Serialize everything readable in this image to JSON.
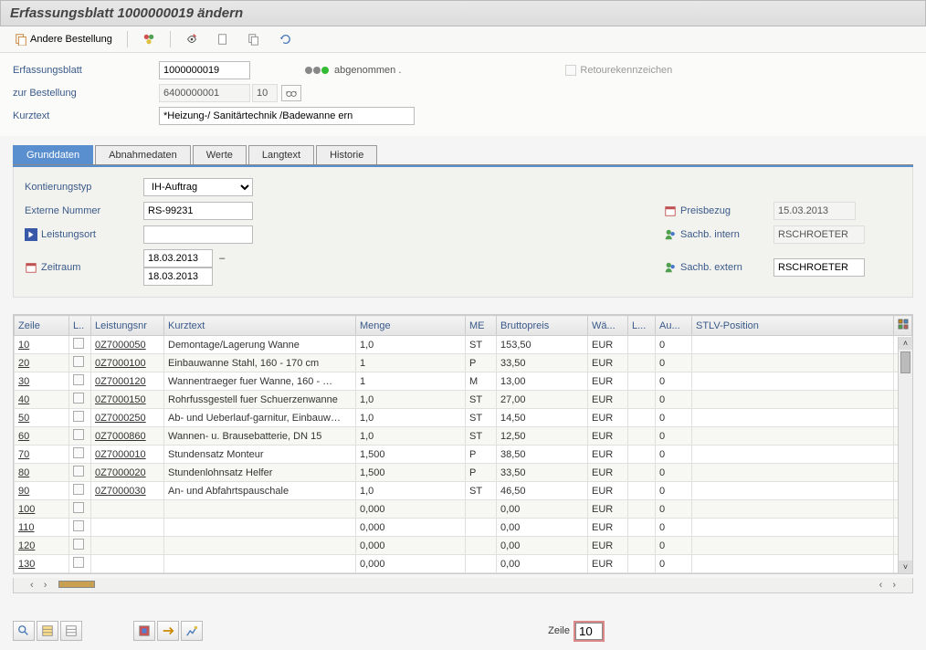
{
  "title": "Erfassungsblatt 1000000019 ändern",
  "toolbar": {
    "other_order": "Andere Bestellung"
  },
  "header": {
    "erfassungsblatt_label": "Erfassungsblatt",
    "erfassungsblatt_value": "1000000019",
    "zur_bestellung_label": "zur Bestellung",
    "bestellung_value": "6400000001",
    "bestellung_pos": "10",
    "kurztext_label": "Kurztext",
    "kurztext_value": "*Heizung-/ Sanitärtechnik /Badewanne ern",
    "status_text": "abgenommen .",
    "retoure_label": "Retourekennzeichen"
  },
  "tabs": [
    "Grunddaten",
    "Abnahmedaten",
    "Werte",
    "Langtext",
    "Historie"
  ],
  "grunddaten": {
    "kontierungstyp_label": "Kontierungstyp",
    "kontierungstyp_value": "IH-Auftrag",
    "externe_nummer_label": "Externe Nummer",
    "externe_nummer_value": "RS-99231",
    "leistungsort_label": "Leistungsort",
    "leistungsort_value": "",
    "zeitraum_label": "Zeitraum",
    "zeitraum_from": "18.03.2013",
    "zeitraum_sep": "–",
    "zeitraum_to": "18.03.2013",
    "preisbezug_label": "Preisbezug",
    "preisbezug_value": "15.03.2013",
    "sachb_intern_label": "Sachb. intern",
    "sachb_intern_value": "RSCHROETER",
    "sachb_extern_label": "Sachb. extern",
    "sachb_extern_value": "RSCHROETER"
  },
  "table": {
    "headers": {
      "zeile": "Zeile",
      "l": "L..",
      "leistungsnr": "Leistungsnr",
      "kurztext": "Kurztext",
      "menge": "Menge",
      "me": "ME",
      "bruttopreis": "Bruttopreis",
      "wae": "Wä...",
      "l2": "L...",
      "au": "Au...",
      "stlv": "STLV-Position"
    },
    "rows": [
      {
        "zeile": "10",
        "lnr": "0Z7000050",
        "txt": "Demontage/Lagerung Wanne",
        "menge": "1,0",
        "me": "ST",
        "preis": "153,50",
        "wae": "EUR",
        "au": "0"
      },
      {
        "zeile": "20",
        "lnr": "0Z7000100",
        "txt": "Einbauwanne Stahl, 160 - 170 cm",
        "menge": "1",
        "me": "P",
        "preis": "33,50",
        "wae": "EUR",
        "au": "0"
      },
      {
        "zeile": "30",
        "lnr": "0Z7000120",
        "txt": "Wannentraeger  fuer Wanne, 160 - …",
        "menge": "1",
        "me": "M",
        "preis": "13,00",
        "wae": "EUR",
        "au": "0"
      },
      {
        "zeile": "40",
        "lnr": "0Z7000150",
        "txt": "Rohrfussgestell fuer Schuerzenwanne",
        "menge": "1,0",
        "me": "ST",
        "preis": "27,00",
        "wae": "EUR",
        "au": "0"
      },
      {
        "zeile": "50",
        "lnr": "0Z7000250",
        "txt": "Ab- und Ueberlauf-garnitur, Einbauw…",
        "menge": "1,0",
        "me": "ST",
        "preis": "14,50",
        "wae": "EUR",
        "au": "0"
      },
      {
        "zeile": "60",
        "lnr": "0Z7000860",
        "txt": "Wannen- u. Brausebatterie, DN 15",
        "menge": "1,0",
        "me": "ST",
        "preis": "12,50",
        "wae": "EUR",
        "au": "0"
      },
      {
        "zeile": "70",
        "lnr": "0Z7000010",
        "txt": "Stundensatz Monteur",
        "menge": "1,500",
        "me": "P",
        "preis": "38,50",
        "wae": "EUR",
        "au": "0"
      },
      {
        "zeile": "80",
        "lnr": "0Z7000020",
        "txt": "Stundenlohnsatz Helfer",
        "menge": "1,500",
        "me": "P",
        "preis": "33,50",
        "wae": "EUR",
        "au": "0"
      },
      {
        "zeile": "90",
        "lnr": "0Z7000030",
        "txt": "An- und Abfahrtspauschale",
        "menge": "1,0",
        "me": "ST",
        "preis": "46,50",
        "wae": "EUR",
        "au": "0"
      },
      {
        "zeile": "100",
        "lnr": "",
        "txt": "",
        "menge": "0,000",
        "me": "",
        "preis": "0,00",
        "wae": "EUR",
        "au": "0"
      },
      {
        "zeile": "110",
        "lnr": "",
        "txt": "",
        "menge": "0,000",
        "me": "",
        "preis": "0,00",
        "wae": "EUR",
        "au": "0"
      },
      {
        "zeile": "120",
        "lnr": "",
        "txt": "",
        "menge": "0,000",
        "me": "",
        "preis": "0,00",
        "wae": "EUR",
        "au": "0"
      },
      {
        "zeile": "130",
        "lnr": "",
        "txt": "",
        "menge": "0,000",
        "me": "",
        "preis": "0,00",
        "wae": "EUR",
        "au": "0"
      }
    ]
  },
  "footer": {
    "zeile_label": "Zeile",
    "zeile_value": "10"
  }
}
